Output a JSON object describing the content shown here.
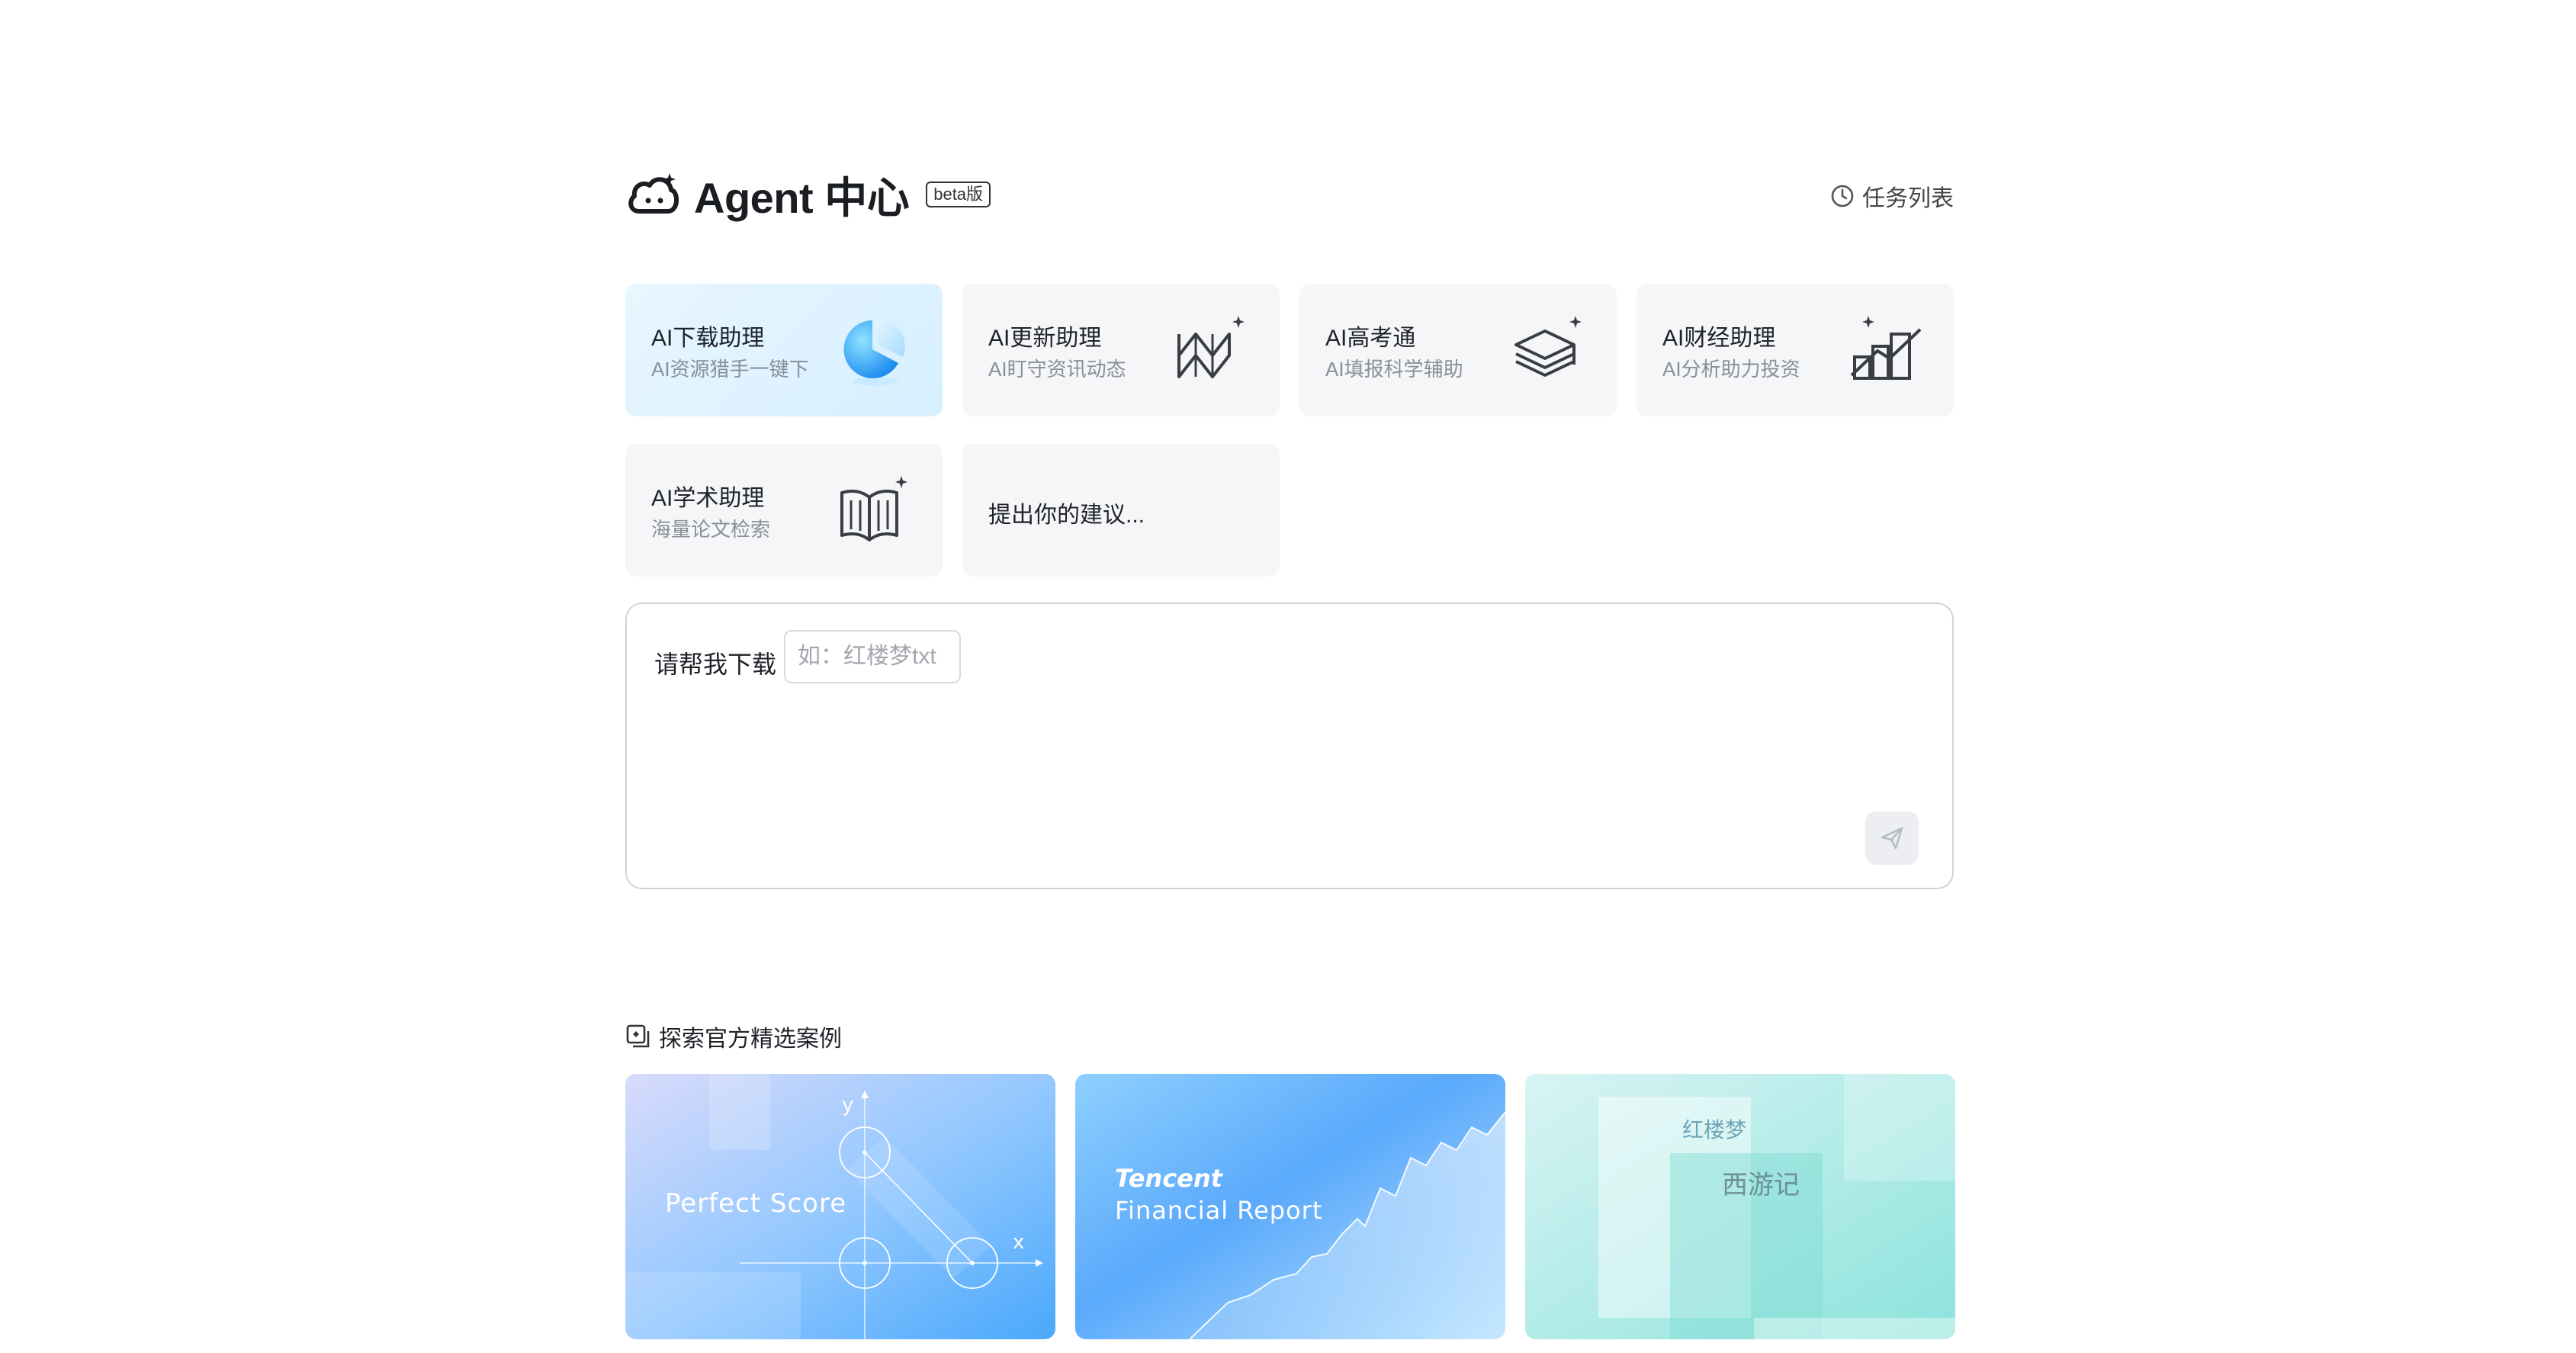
{
  "header": {
    "title": "Agent 中心",
    "badge": "beta版",
    "task_list_label": "任务列表"
  },
  "agents": [
    {
      "title": "AI下载助理",
      "subtitle": "AI资源猎手一键下",
      "icon": "pie-chart-icon"
    },
    {
      "title": "AI更新助理",
      "subtitle": "AI盯守资讯动态",
      "icon": "wave-sparkle-icon"
    },
    {
      "title": "AI高考通",
      "subtitle": "AI填报科学辅助",
      "icon": "layers-sparkle-icon"
    },
    {
      "title": "AI财经助理",
      "subtitle": "AI分析助力投资",
      "icon": "bar-chart-sparkle-icon"
    },
    {
      "title": "AI学术助理",
      "subtitle": "海量论文检索",
      "icon": "book-sparkle-icon"
    },
    {
      "title": "提出你的建议...",
      "subtitle": "",
      "icon": ""
    }
  ],
  "prompt": {
    "label": "请帮我下载",
    "placeholder": "如：红楼梦txt"
  },
  "explore": {
    "title": "探索官方精选案例"
  },
  "cases": [
    {
      "title": "Perfect Score",
      "axis_y": "y",
      "axis_x": "x"
    },
    {
      "title_line1": "Tencent",
      "title_line2": "Financial Report"
    },
    {
      "book1": "红楼梦",
      "book2": "西游记"
    }
  ],
  "colors": {
    "accent_light": "#e8f6ff",
    "card_bg": "#f5f6f8",
    "border": "#d0d3d9"
  }
}
